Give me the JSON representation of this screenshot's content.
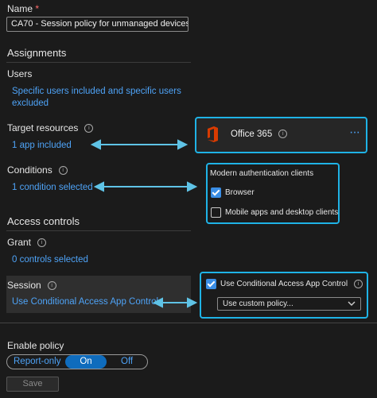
{
  "name": {
    "label": "Name",
    "required_mark": "*",
    "value": "CA70 - Session policy for unmanaged devices"
  },
  "assignments": {
    "title": "Assignments",
    "users": {
      "label": "Users",
      "value": "Specific users included and specific users excluded"
    },
    "target_resources": {
      "label": "Target resources",
      "value": "1 app included"
    },
    "conditions": {
      "label": "Conditions",
      "value": "1 condition selected"
    }
  },
  "access_controls": {
    "title": "Access controls",
    "grant": {
      "label": "Grant",
      "value": "0 controls selected"
    },
    "session": {
      "label": "Session",
      "value": "Use Conditional Access App Control"
    }
  },
  "callout_app": {
    "name": "Office 365",
    "more": "···"
  },
  "callout_conditions": {
    "title": "Modern authentication clients",
    "browser": {
      "label": "Browser",
      "checked": true
    },
    "mobile": {
      "label": "Mobile apps and desktop clients",
      "checked": false
    }
  },
  "callout_session": {
    "checkbox_label": "Use Conditional Access App Control",
    "checked": true,
    "dropdown_value": "Use custom policy..."
  },
  "enable_policy": {
    "label": "Enable policy",
    "options": [
      "Report-only",
      "On",
      "Off"
    ],
    "selected": "On"
  },
  "save_label": "Save",
  "colors": {
    "accent": "#1fb3e6",
    "link": "#4ea3f7",
    "selected": "#0f6cbd",
    "background": "#1b1b1b"
  }
}
